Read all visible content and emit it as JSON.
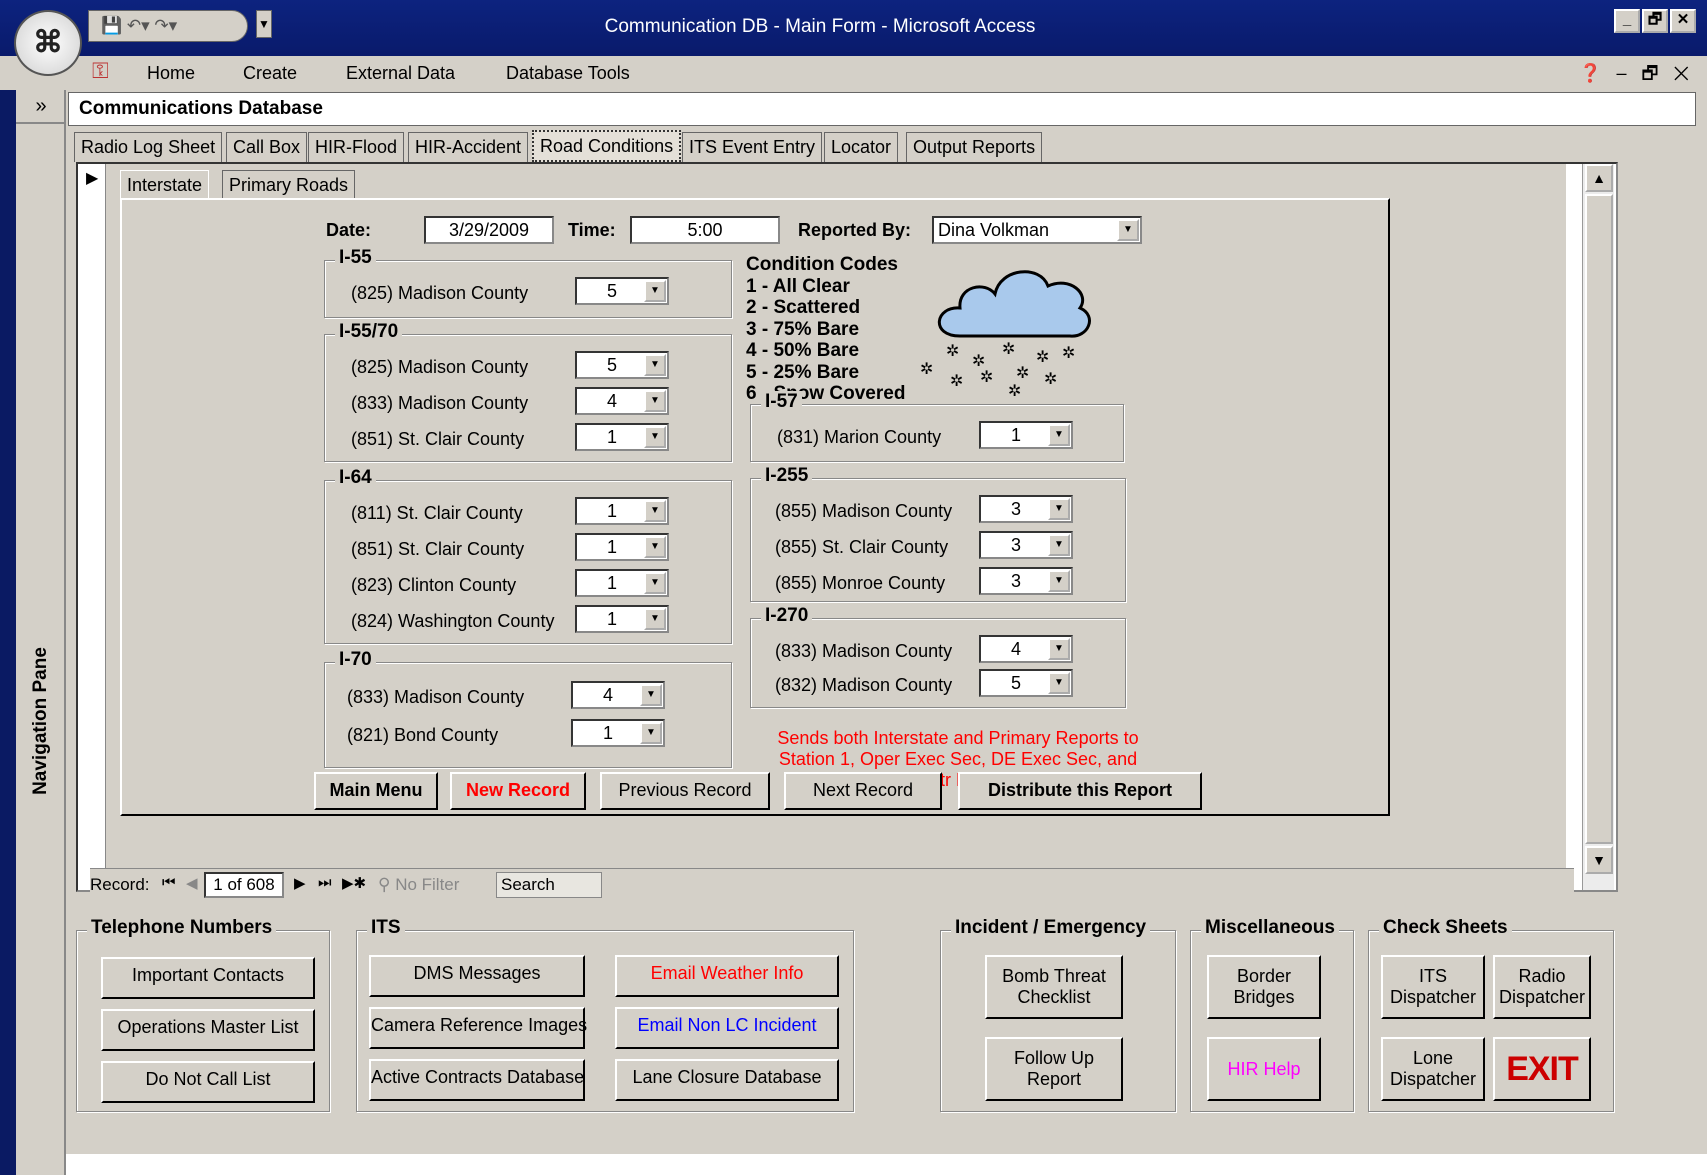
{
  "window": {
    "title": "Communication DB - Main Form - Microsoft Access",
    "controls": [
      "_",
      "🗗",
      "✕"
    ]
  },
  "ribbon": {
    "tabs": [
      "Home",
      "Create",
      "External Data",
      "Database Tools"
    ]
  },
  "nav_pane": {
    "label": "Navigation Pane"
  },
  "form": {
    "title": "Communications Database",
    "tabs": [
      "Radio Log Sheet",
      "Call Box",
      "HIR-Flood",
      "HIR-Accident",
      "Road Conditions",
      "ITS Event Entry",
      "Locator",
      "Output Reports"
    ],
    "active_tab": "Road Conditions",
    "subtabs": [
      "Interstate",
      "Primary Roads"
    ],
    "date_label": "Date:",
    "date": "3/29/2009",
    "time_label": "Time:",
    "time": "5:00",
    "reported_by_label": "Reported By:",
    "reported_by": "Dina Volkman",
    "groups": {
      "i55": {
        "title": "I-55",
        "rows": [
          {
            "label": "(825) Madison County",
            "value": "5"
          }
        ]
      },
      "i5570": {
        "title": "I-55/70",
        "rows": [
          {
            "label": "(825) Madison County",
            "value": "5"
          },
          {
            "label": "(833) Madison County",
            "value": "4"
          },
          {
            "label": "(851) St. Clair County",
            "value": "1"
          }
        ]
      },
      "i64": {
        "title": "I-64",
        "rows": [
          {
            "label": "(811) St. Clair County",
            "value": "1"
          },
          {
            "label": "(851) St. Clair County",
            "value": "1"
          },
          {
            "label": "(823) Clinton County",
            "value": "1"
          },
          {
            "label": "(824) Washington County",
            "value": "1"
          }
        ]
      },
      "i70": {
        "title": "I-70",
        "rows": [
          {
            "label": "(833) Madison County",
            "value": "4"
          },
          {
            "label": "(821) Bond County",
            "value": "1"
          }
        ]
      },
      "i57": {
        "title": "I-57",
        "rows": [
          {
            "label": "(831) Marion County",
            "value": "1"
          }
        ]
      },
      "i255": {
        "title": "I-255",
        "rows": [
          {
            "label": "(855) Madison County",
            "value": "3"
          },
          {
            "label": "(855) St. Clair County",
            "value": "3"
          },
          {
            "label": "(855) Monroe County",
            "value": "3"
          }
        ]
      },
      "i270": {
        "title": "I-270",
        "rows": [
          {
            "label": "(833) Madison County",
            "value": "4"
          },
          {
            "label": "(832) Madison County",
            "value": "5"
          }
        ]
      }
    },
    "condition_codes": {
      "title": "Condition Codes",
      "codes": [
        "1 - All Clear",
        "2 - Scattered",
        "3 - 75% Bare",
        "4 - 50% Bare",
        "5 - 25% Bare",
        "6 - Snow Covered"
      ]
    },
    "notice": "Sends both Interstate and Primary Reports to Station 1, Oper Exec Sec, DE Exec Sec, and Comm Ctr PRINTERS",
    "buttons": {
      "main_menu": "Main Menu",
      "new_record": "New Record",
      "previous": "Previous Record",
      "next": "Next Record",
      "distribute": "Distribute this Report"
    },
    "record_nav": {
      "label": "Record:",
      "position": "1 of 608",
      "filter": "No Filter",
      "search": "Search"
    }
  },
  "bottom": {
    "telephone": {
      "title": "Telephone Numbers",
      "buttons": [
        "Important Contacts",
        "Operations Master List",
        "Do Not Call List"
      ]
    },
    "its": {
      "title": "ITS",
      "buttons": [
        "DMS Messages",
        "Camera Reference Images",
        "Active Contracts Database",
        "Email Weather Info",
        "Email Non LC Incident",
        "Lane Closure Database"
      ]
    },
    "incident": {
      "title": "Incident / Emergency",
      "buttons": [
        "Bomb Threat Checklist",
        "Follow Up Report"
      ]
    },
    "misc": {
      "title": "Miscellaneous",
      "buttons": [
        "Border Bridges",
        "HIR Help"
      ]
    },
    "check": {
      "title": "Check Sheets",
      "buttons": [
        "ITS Dispatcher",
        "Radio Dispatcher",
        "Lone Dispatcher",
        "EXIT"
      ]
    }
  },
  "colors": {
    "title_bar": "#0d237f",
    "panel": "#d4d0c8",
    "red": "#ff0000",
    "blue": "#0000ff",
    "magenta": "#ff00ff",
    "exit": "#cc0000"
  }
}
